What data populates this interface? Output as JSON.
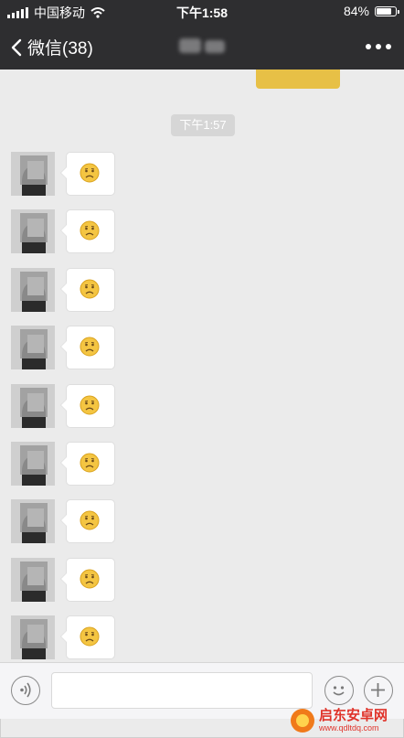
{
  "status_bar": {
    "carrier": "中国移动",
    "time": "下午1:58",
    "battery": "84%",
    "battery_level": 0.84
  },
  "nav": {
    "back_label": "微信(38)"
  },
  "chat": {
    "timestamp": "下午1:57",
    "messages": [
      {
        "emoji": "frowning-face-emoji"
      },
      {
        "emoji": "frowning-face-emoji"
      },
      {
        "emoji": "frowning-face-emoji"
      },
      {
        "emoji": "frowning-face-emoji"
      },
      {
        "emoji": "frowning-face-emoji"
      },
      {
        "emoji": "frowning-face-emoji"
      },
      {
        "emoji": "frowning-face-emoji"
      },
      {
        "emoji": "frowning-face-emoji"
      },
      {
        "emoji": "frowning-face-emoji"
      }
    ]
  },
  "input_bar": {
    "text": ""
  },
  "watermark": {
    "name": "启东安卓网",
    "url": "www.qdltdq.com"
  },
  "colors": {
    "bar_bg": "#2e2e30",
    "chat_bg": "#ebebeb",
    "accent_yellow": "#e7c046",
    "watermark_red": "#e0332a"
  }
}
